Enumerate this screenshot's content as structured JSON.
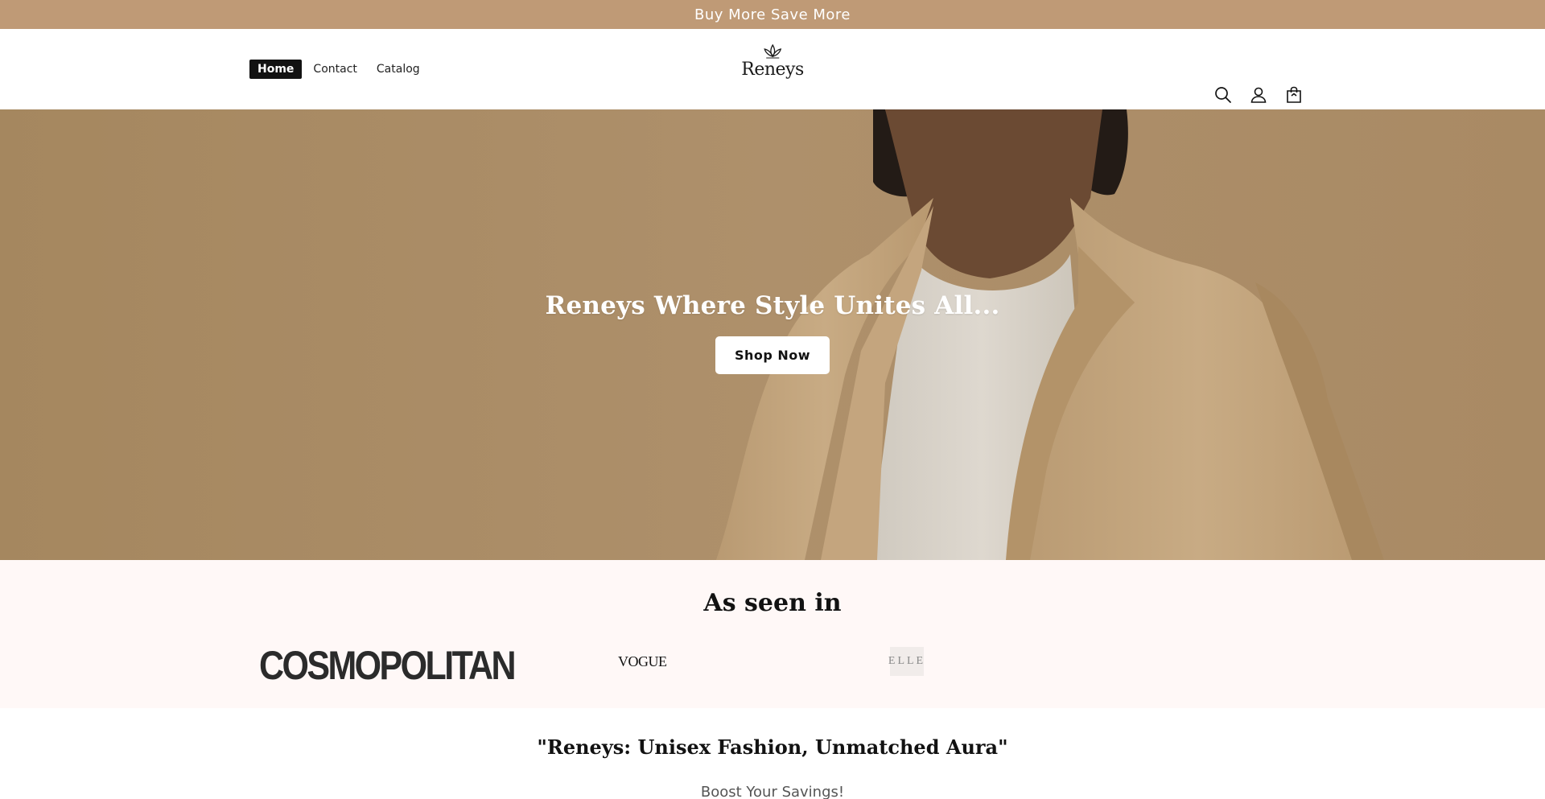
{
  "announcement": {
    "text": "Buy More Save More"
  },
  "nav": {
    "items": [
      {
        "label": "Home",
        "active": true
      },
      {
        "label": "Contact",
        "active": false
      },
      {
        "label": "Catalog",
        "active": false
      }
    ]
  },
  "brand": {
    "name": "Reneys"
  },
  "header_icons": [
    "search-icon",
    "account-icon",
    "cart-icon"
  ],
  "hero": {
    "title": "Reneys  Where Style Unites All...",
    "button_label": "Shop Now"
  },
  "press": {
    "title": "As seen in",
    "logos": [
      "COSMOPOLITAN",
      "VOGUE",
      "ELLE"
    ]
  },
  "tagline": {
    "text": "\"Reneys: Unisex Fashion, Unmatched Aura\"",
    "subtext": "Boost Your Savings!"
  },
  "colors": {
    "announcement_bg": "#bf9a76",
    "press_bg": "#fff8f7",
    "nav_active_bg": "#121212"
  }
}
